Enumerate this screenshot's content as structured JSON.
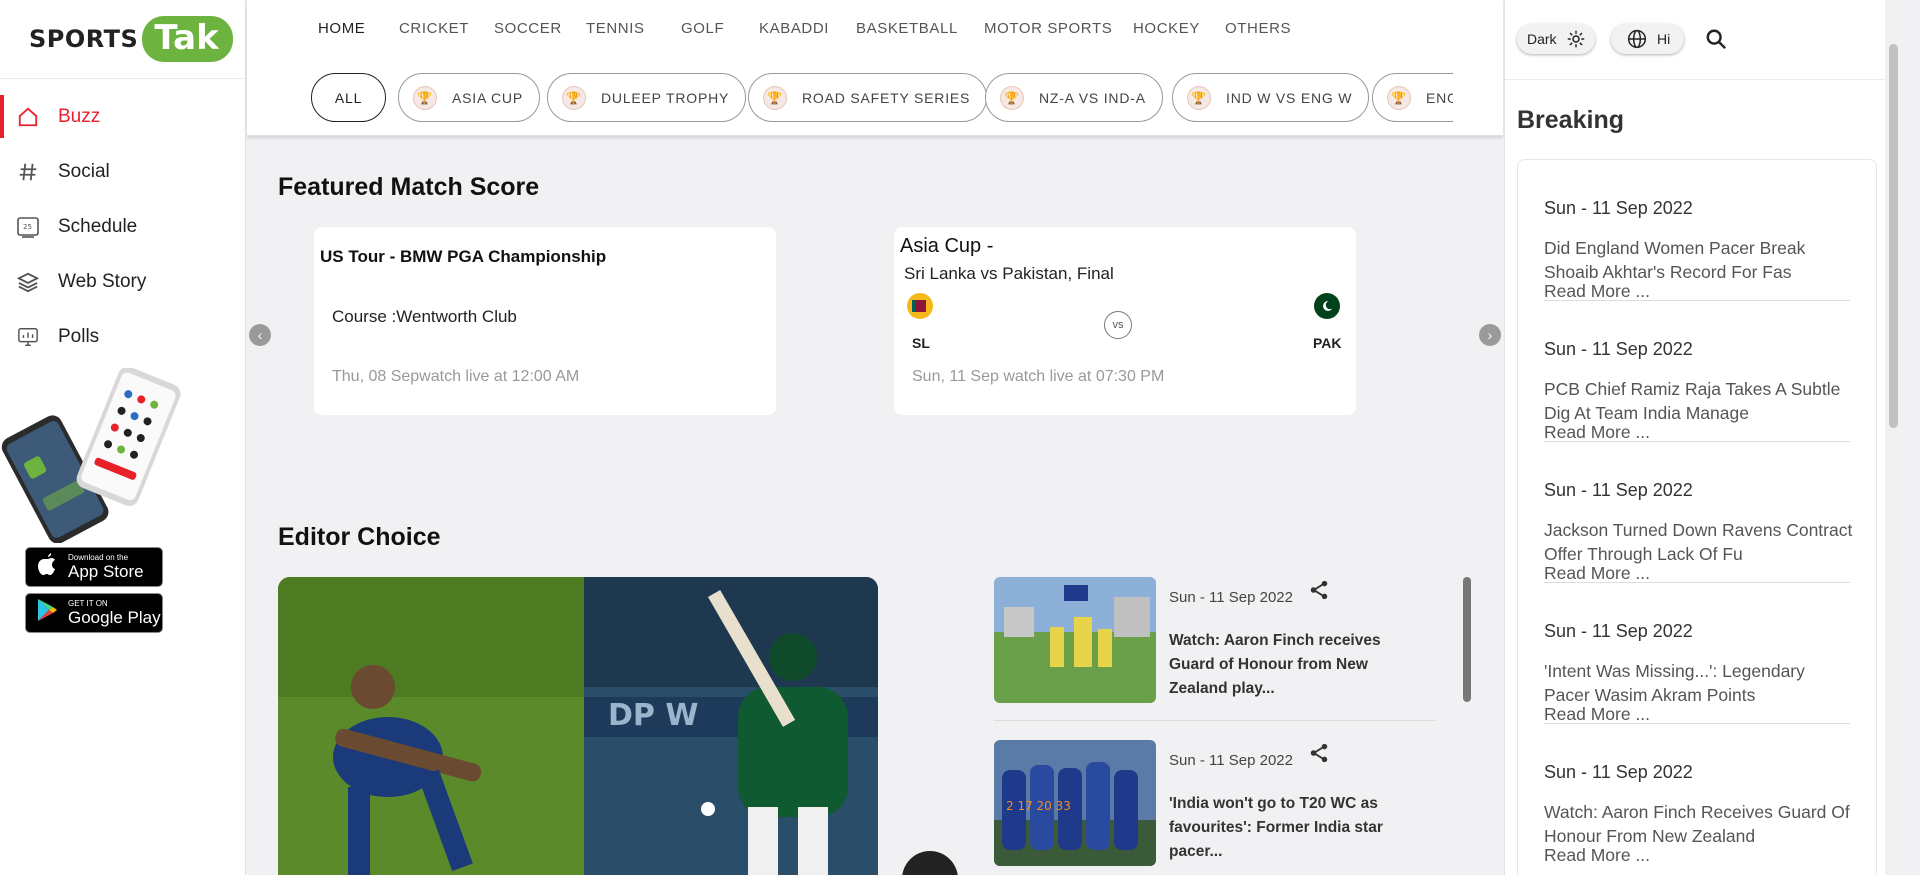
{
  "brand": {
    "name_left": "SPORTS",
    "name_badge": "Tak",
    "accent": "#e8202a",
    "badge_color": "#6cb33f"
  },
  "sidebar": {
    "items": [
      {
        "label": "Buzz",
        "icon": "home-icon",
        "active": true
      },
      {
        "label": "Social",
        "icon": "hashtag-icon"
      },
      {
        "label": "Schedule",
        "icon": "calendar-icon"
      },
      {
        "label": "Web Story",
        "icon": "layers-icon"
      },
      {
        "label": "Polls",
        "icon": "poll-icon"
      }
    ],
    "app_store": {
      "small": "Download on the",
      "big": "App Store"
    },
    "google_play": {
      "small": "GET IT ON",
      "big": "Google Play"
    }
  },
  "top_nav": {
    "sports": [
      "HOME",
      "CRICKET",
      "SOCCER",
      "TENNIS",
      "GOLF",
      "KABADDI",
      "BASKETBALL",
      "MOTOR SPORTS",
      "HOCKEY",
      "OTHERS"
    ],
    "filters": [
      "ALL",
      "ASIA CUP",
      "DULEEP TROPHY",
      "ROAD SAFETY SERIES",
      "NZ-A VS IND-A",
      "IND W VS ENG W",
      "ENG"
    ]
  },
  "featured": {
    "title": "Featured Match Score",
    "cards": [
      {
        "series": "US Tour - BMW PGA Championship",
        "detail": "Course :Wentworth Club",
        "time": "Thu, 08 Sepwatch live at 12:00 AM"
      },
      {
        "series": "Asia Cup -",
        "match": "Sri Lanka vs Pakistan, Final",
        "team1": "SL",
        "team2": "PAK",
        "vs": "vs",
        "time": "Sun, 11 Sep watch live at 07:30 PM"
      }
    ]
  },
  "editor_choice": {
    "title": "Editor Choice",
    "stories": [
      {
        "date": "Sun - 11 Sep 2022",
        "title": "Watch: Aaron Finch receives Guard of Honour from New Zealand play..."
      },
      {
        "date": "Sun - 11 Sep 2022",
        "title": "'India won't go to T20 WC as favourites': Former India star pacer..."
      }
    ]
  },
  "right_panel": {
    "theme_label": "Dark",
    "language_label": "Hi",
    "breaking_title": "Breaking",
    "read_more": "Read More ...",
    "items": [
      {
        "date": "Sun - 11 Sep 2022",
        "title": "Did England Women Pacer Break Shoaib Akhtar's Record For Fas"
      },
      {
        "date": "Sun - 11 Sep 2022",
        "title": "PCB Chief Ramiz Raja Takes A Subtle Dig At Team India Manage"
      },
      {
        "date": "Sun - 11 Sep 2022",
        "title": "Jackson Turned Down Ravens Contract Offer Through Lack Of Fu"
      },
      {
        "date": "Sun - 11 Sep 2022",
        "title": "'Intent Was Missing...': Legendary Pacer Wasim Akram Points"
      },
      {
        "date": "Sun - 11 Sep 2022",
        "title": "Watch: Aaron Finch Receives Guard Of Honour From New Zealand"
      }
    ]
  }
}
